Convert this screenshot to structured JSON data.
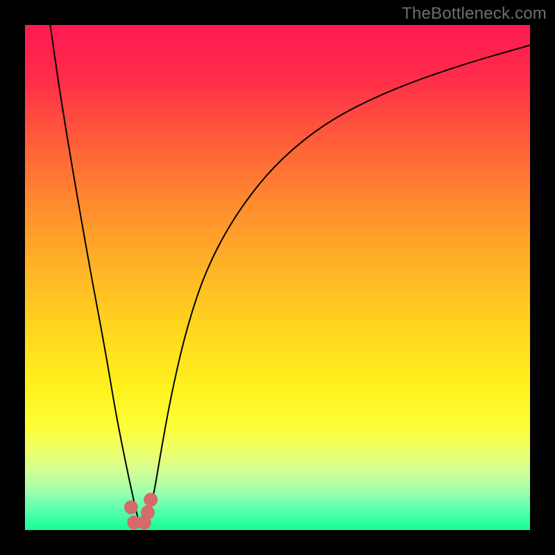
{
  "watermark": "TheBottleneck.com",
  "chart_data": {
    "type": "line",
    "title": "",
    "xlabel": "",
    "ylabel": "",
    "xlim": [
      0,
      100
    ],
    "ylim": [
      0,
      100
    ],
    "grid": false,
    "series": [
      {
        "name": "curve",
        "x": [
          5,
          7,
          10,
          13,
          16,
          18,
          20,
          21.5,
          22.8,
          24,
          25.5,
          27,
          29,
          32,
          36,
          42,
          50,
          60,
          72,
          86,
          100
        ],
        "y": [
          100,
          86,
          68,
          51,
          35,
          23,
          13,
          6,
          0.5,
          0.5,
          7,
          16,
          27,
          40,
          52,
          63,
          73,
          81,
          87,
          92,
          96
        ]
      },
      {
        "name": "highlight-points",
        "x": [
          21.0,
          21.6,
          23.6,
          24.3,
          24.9
        ],
        "y": [
          4.5,
          1.5,
          1.5,
          3.5,
          6.0
        ]
      }
    ],
    "background_gradient_stops": [
      {
        "pct": 0,
        "color": "#ff1a52"
      },
      {
        "pct": 10,
        "color": "#ff2b4a"
      },
      {
        "pct": 22,
        "color": "#ff5a3a"
      },
      {
        "pct": 35,
        "color": "#ff8a2f"
      },
      {
        "pct": 48,
        "color": "#ffb326"
      },
      {
        "pct": 60,
        "color": "#ffd51f"
      },
      {
        "pct": 72,
        "color": "#fff21c"
      },
      {
        "pct": 80,
        "color": "#fbff3a"
      },
      {
        "pct": 84,
        "color": "#efff66"
      },
      {
        "pct": 88,
        "color": "#d6ff8f"
      },
      {
        "pct": 92,
        "color": "#a8ffab"
      },
      {
        "pct": 96,
        "color": "#5effb0"
      },
      {
        "pct": 100,
        "color": "#19ff95"
      }
    ],
    "highlight_color": "#d46a6a",
    "curve_color": "#000000"
  }
}
